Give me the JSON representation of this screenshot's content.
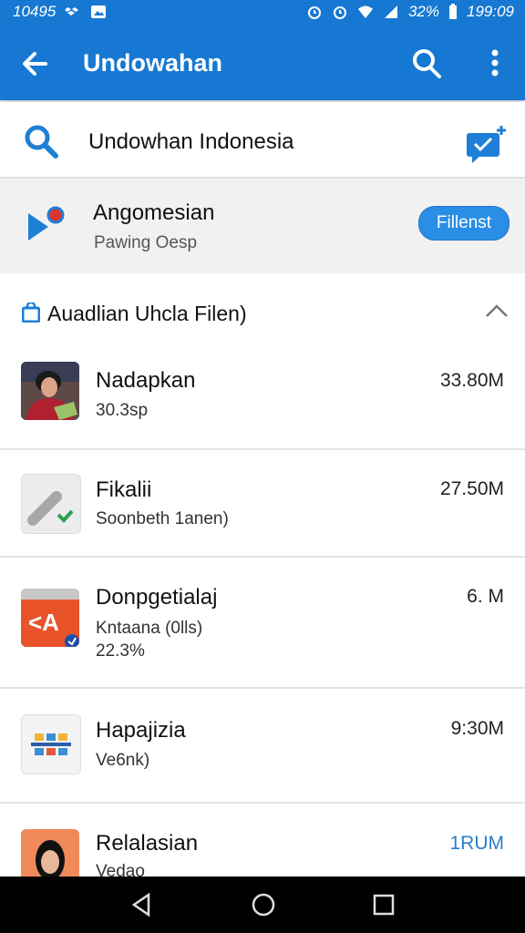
{
  "status_bar": {
    "left_text": "10495",
    "battery": "32%",
    "time": "199:09"
  },
  "app_bar": {
    "title": "Undowahan"
  },
  "search": {
    "query": "Undowhan Indonesia"
  },
  "featured": {
    "title": "Angomesian",
    "subtitle": "Pawing Oesp",
    "button_label": "Fillenst"
  },
  "section": {
    "title": "Auadlian Uhcla Filen)"
  },
  "items": [
    {
      "name": "Nadapkan",
      "sub": "30.3sp",
      "size": "33.80M",
      "thumb": "person-photo"
    },
    {
      "name": "Fikalii",
      "sub": "Soonbeth 1anen)",
      "size": "27.50M",
      "thumb": "phone-app-icon"
    },
    {
      "name": "Donpgetialaj",
      "sub": "Kntaana (0lls)",
      "sub2": "22.3%",
      "size": "6. M",
      "thumb": "orange-app-icon"
    },
    {
      "name": "Hapajizia",
      "sub": "Ve6nk)",
      "size": "9:30M",
      "thumb": "blocks-app-icon"
    },
    {
      "name": "Relalasian",
      "sub": "Vedao",
      "size": "1RUM",
      "size_color": "#2a7fc9",
      "thumb": "person-photo"
    }
  ],
  "colors": {
    "primary": "#1678d2",
    "accent": "#2a8ee6"
  }
}
